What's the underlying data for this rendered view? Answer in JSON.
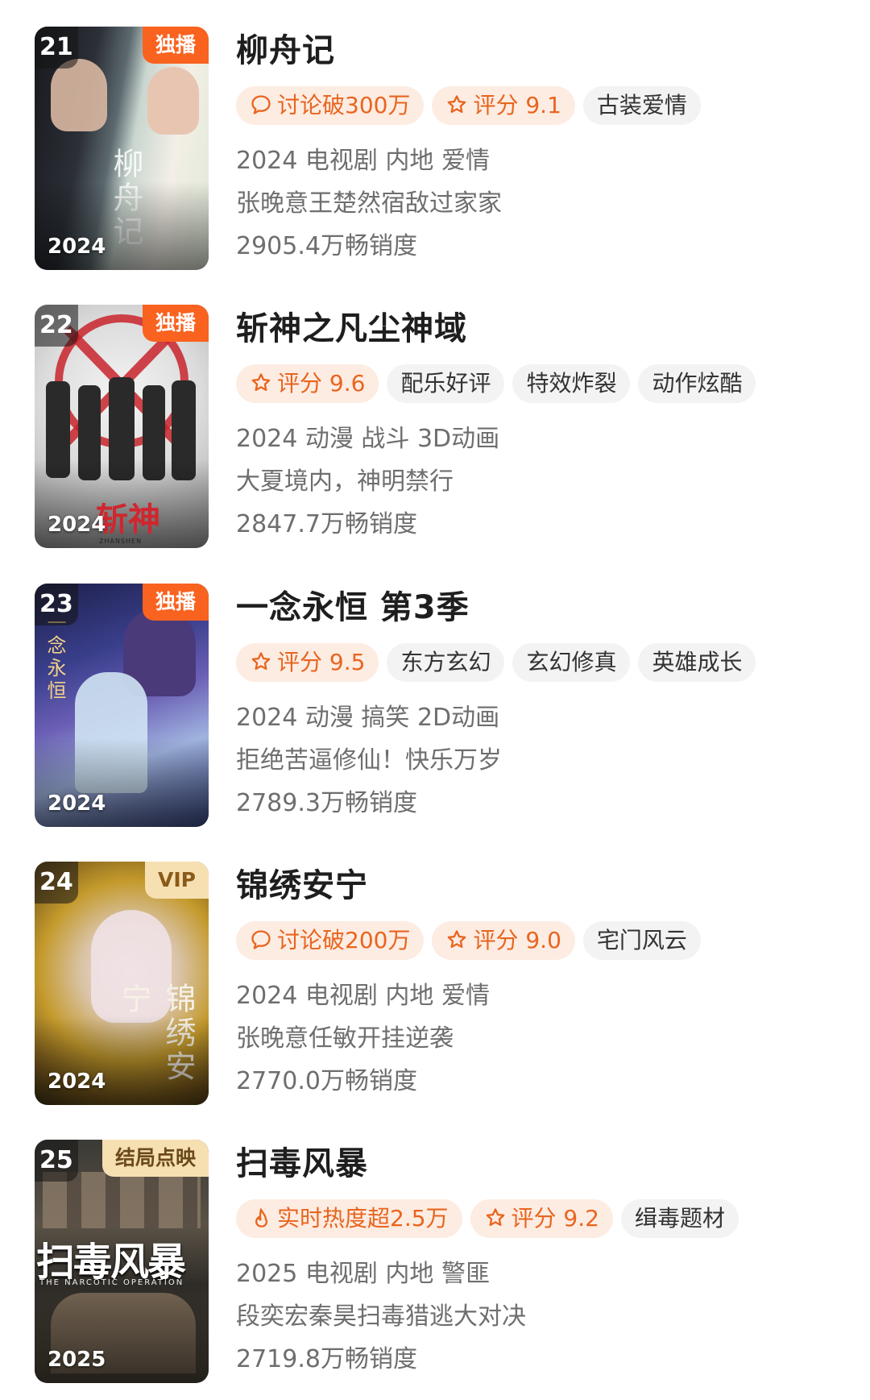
{
  "items": [
    {
      "rank": "21",
      "corner": "独播",
      "poster_year": "2024",
      "poster_text": "柳舟记",
      "title": "柳舟记",
      "tags": [
        {
          "icon": "chat-bubble-icon",
          "text": "讨论破300万"
        },
        {
          "icon": "star-icon",
          "text": "评分 9.1"
        },
        {
          "icon": "",
          "text": "古装爱情"
        }
      ],
      "info": "2024 电视剧 内地 爱情",
      "desc": "张晚意王楚然宿敌过家家",
      "sales": "2905.4万畅销度"
    },
    {
      "rank": "22",
      "corner": "独播",
      "poster_year": "2024",
      "poster_text": "斩神",
      "poster_sub": "ZHANSHEN",
      "title": "斩神之凡尘神域",
      "tags": [
        {
          "icon": "star-icon",
          "text": "评分 9.6"
        },
        {
          "icon": "",
          "text": "配乐好评"
        },
        {
          "icon": "",
          "text": "特效炸裂"
        },
        {
          "icon": "",
          "text": "动作炫酷"
        }
      ],
      "info": "2024 动漫 战斗 3D动画",
      "desc": "大夏境内，神明禁行",
      "sales": "2847.7万畅销度"
    },
    {
      "rank": "23",
      "corner": "独播",
      "poster_year": "2024",
      "poster_text": "一念永恒",
      "title": "一念永恒 第3季",
      "tags": [
        {
          "icon": "star-icon",
          "text": "评分 9.5"
        },
        {
          "icon": "",
          "text": "东方玄幻"
        },
        {
          "icon": "",
          "text": "玄幻修真"
        },
        {
          "icon": "",
          "text": "英雄成长"
        }
      ],
      "info": "2024 动漫 搞笑 2D动画",
      "desc": "拒绝苦逼修仙！快乐万岁",
      "sales": "2789.3万畅销度"
    },
    {
      "rank": "24",
      "corner": "VIP",
      "poster_year": "2024",
      "poster_text": "锦绣安宁",
      "title": "锦绣安宁",
      "tags": [
        {
          "icon": "chat-bubble-icon",
          "text": "讨论破200万"
        },
        {
          "icon": "star-icon",
          "text": "评分 9.0"
        },
        {
          "icon": "",
          "text": "宅门风云"
        }
      ],
      "info": "2024 电视剧 内地 爱情",
      "desc": "张晚意任敏开挂逆袭",
      "sales": "2770.0万畅销度"
    },
    {
      "rank": "25",
      "corner": "结局点映",
      "poster_year": "2025",
      "poster_text": "扫毒风暴",
      "poster_sub": "THE NARCOTIC OPERATION",
      "title": "扫毒风暴",
      "tags": [
        {
          "icon": "flame-icon",
          "text": "实时热度超2.5万"
        },
        {
          "icon": "star-icon",
          "text": "评分 9.2"
        },
        {
          "icon": "",
          "text": "缉毒题材"
        }
      ],
      "info": "2025 电视剧 内地 警匪",
      "desc": "段奕宏秦昊扫毒猎逃大对决",
      "sales": "2719.8万畅销度"
    }
  ],
  "colors": {
    "accent": "#e8651f",
    "hot_tag_bg": "#fdece2",
    "plain_tag_bg": "#f3f3f3",
    "corner_orange": "#f9621f",
    "corner_gold": "#f6dfb1",
    "meta_text": "#6e6e6e"
  }
}
